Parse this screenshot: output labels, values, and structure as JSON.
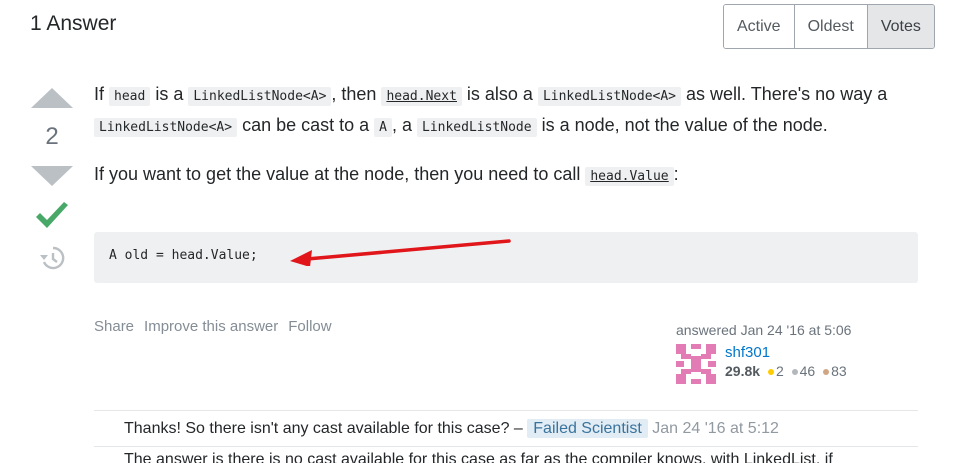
{
  "header": {
    "title": "1 Answer"
  },
  "sort_tabs": [
    {
      "label": "Active",
      "active": false
    },
    {
      "label": "Oldest",
      "active": false
    },
    {
      "label": "Votes",
      "active": true
    }
  ],
  "votes": {
    "count": "2",
    "accepted": true
  },
  "body": {
    "p1": {
      "t1": "If ",
      "c1": "head",
      "t2": " is a ",
      "c2": "LinkedListNode<A>",
      "t3": ", then ",
      "c3": "head.Next",
      "t4": " is also a ",
      "c4": "LinkedListNode<A>",
      "t5": " as well. There's no way a ",
      "c5": "LinkedListNode<A>",
      "t6": " can be cast to a ",
      "c6": "A",
      "t7": ", a ",
      "c7": "LinkedListNode",
      "t8": " is a node, not the value of the node."
    },
    "p2": {
      "t1": "If you want to get the value at the node, then you need to call ",
      "c1": "head.Value",
      "t2": ":"
    },
    "code_block": "A old = head.Value;"
  },
  "post_menu": {
    "share": "Share",
    "improve": "Improve this answer",
    "follow": "Follow"
  },
  "user": {
    "action_time": "answered Jan 24 '16 at 5:06",
    "name": "shf301",
    "reputation": "29.8k",
    "gold": "2",
    "silver": "46",
    "bronze": "83"
  },
  "colors": {
    "gold": "#ffcc01",
    "silver": "#b4b8bc",
    "bronze": "#d1a684",
    "accepted": "#48a868",
    "arrow": "#e0161b"
  },
  "comments": [
    {
      "text": "Thanks! So there isn't any cast available for this case? –",
      "user": "Failed Scientist",
      "date": "Jan 24 '16 at 5:12"
    },
    {
      "text": "The answer is there is no cast available for this case as far as the compiler knows, with LinkedList, if"
    }
  ]
}
